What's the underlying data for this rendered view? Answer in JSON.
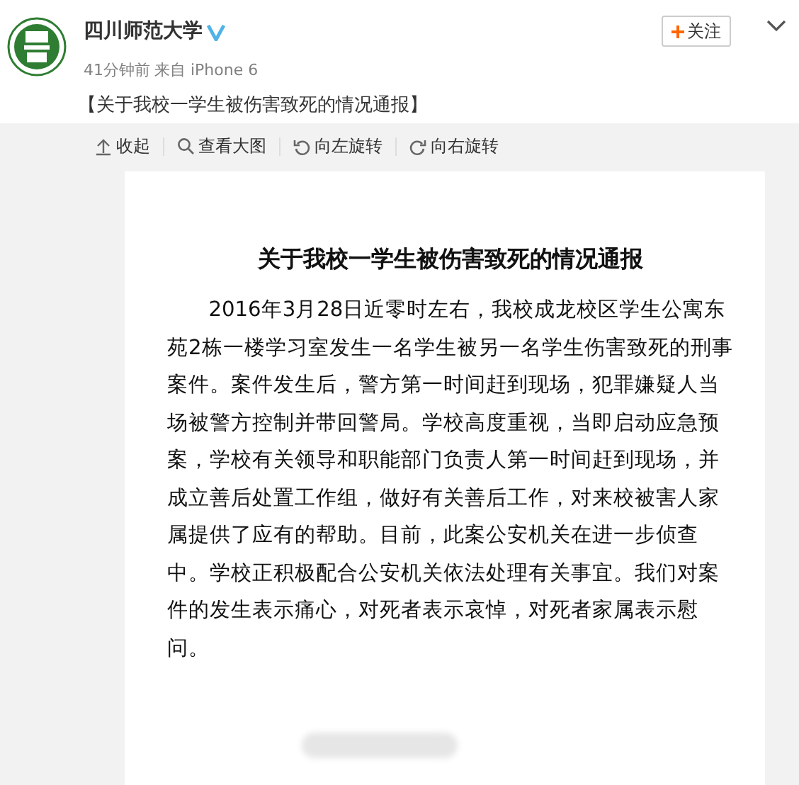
{
  "account": {
    "name": "四川师范大学",
    "verified": true,
    "time": "41分钟前",
    "source": "来自 iPhone 6",
    "follow": "关注"
  },
  "post_text": "【关于我校一学生被伤害致死的情况通报】",
  "toolbar": [
    {
      "label": "收起",
      "kind": "collapse"
    },
    {
      "label": "查看大图",
      "kind": "zoom"
    },
    {
      "label": "向左旋转",
      "kind": "rotate-left"
    },
    {
      "label": "向右旋转",
      "kind": "rotate-right"
    }
  ],
  "document": {
    "title": "关于我校一学生被伤害致死的情况通报",
    "body": "2016年3月28日近零时左右，我校成龙校区学生公寓东苑2栋一楼学习室发生一名学生被另一名学生伤害致死的刑事案件。案件发生后，警方第一时间赶到现场，犯罪嫌疑人当场被警方控制并带回警局。学校高度重视，当即启动应急预案，学校有关领导和职能部门负责人第一时间赶到现场，并成立善后处置工作组，做好有关善后工作，对来校被害人家属提供了应有的帮助。目前，此案公安机关在进一步侦查中。学校正积极配合公安机关依法处理有关事宜。我们对案件的发生表示痛心，对死者表示哀悼，对死者家属表示慰问。"
  }
}
